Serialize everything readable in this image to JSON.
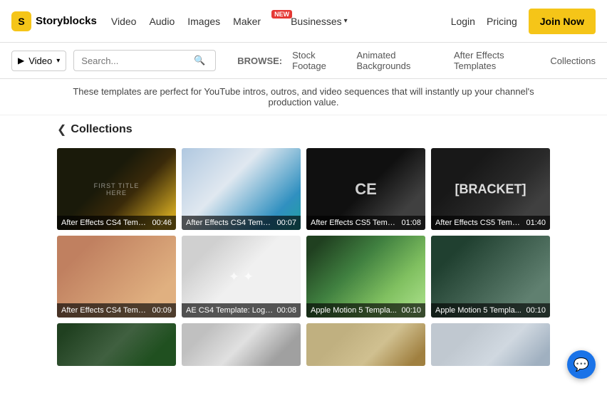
{
  "header": {
    "logo_letter": "S",
    "logo_text": "Storyblocks",
    "nav_items": [
      {
        "label": "Video",
        "has_badge": false
      },
      {
        "label": "Audio",
        "has_badge": false
      },
      {
        "label": "Images",
        "has_badge": false
      },
      {
        "label": "Maker",
        "has_badge": true,
        "badge_text": "NEW"
      },
      {
        "label": "Businesses",
        "has_dropdown": true
      }
    ],
    "login_label": "Login",
    "pricing_label": "Pricing",
    "join_label": "Join Now"
  },
  "search": {
    "type_label": "Video",
    "placeholder": "Search...",
    "browse_label": "BROWSE:",
    "browse_links": [
      {
        "label": "Stock Footage"
      },
      {
        "label": "Animated Backgrounds"
      },
      {
        "label": "After Effects Templates"
      },
      {
        "label": "Collections"
      }
    ]
  },
  "description": "These templates are perfect for YouTube intros, outros, and video sequences that will instantly up your channel's production value.",
  "collections": {
    "title": "Collections",
    "back_icon": "❮"
  },
  "videos": [
    {
      "title": "After Effects CS4 Templa...",
      "duration": "00:46",
      "thumb_class": "thumb-1",
      "overlay_type": "first-title"
    },
    {
      "title": "After Effects CS4 Templa...",
      "duration": "00:07",
      "thumb_class": "thumb-2",
      "overlay_type": "none"
    },
    {
      "title": "After Effects CS5 Templa...",
      "duration": "01:08",
      "thumb_class": "thumb-3",
      "overlay_type": "ce"
    },
    {
      "title": "After Effects CS5 Templa...",
      "duration": "01:40",
      "thumb_class": "thumb-4",
      "overlay_type": "bracket"
    },
    {
      "title": "After Effects CS4 Templa...",
      "duration": "00:09",
      "thumb_class": "thumb-5",
      "overlay_type": "none"
    },
    {
      "title": "AE CS4 Template: Logo ...",
      "duration": "00:08",
      "thumb_class": "thumb-6",
      "overlay_type": "birds"
    },
    {
      "title": "Apple Motion 5 Templa...",
      "duration": "00:10",
      "thumb_class": "thumb-7",
      "overlay_type": "none"
    },
    {
      "title": "Apple Motion 5 Templa...",
      "duration": "00:10",
      "thumb_class": "thumb-8",
      "overlay_type": "none"
    }
  ],
  "partial_videos": [
    {
      "thumb_class": "thumb-9"
    },
    {
      "thumb_class": "thumb-10"
    },
    {
      "thumb_class": "thumb-11"
    },
    {
      "thumb_class": "thumb-12"
    }
  ],
  "chat": {
    "icon": "💬"
  }
}
